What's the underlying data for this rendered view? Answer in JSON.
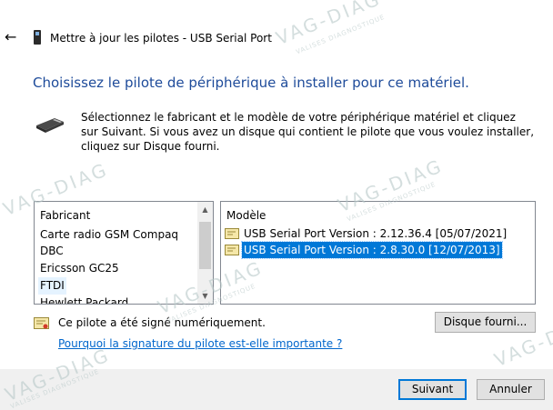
{
  "titlebar": {
    "title": "Mettre à jour les pilotes - USB Serial Port"
  },
  "heading": "Choisissez le pilote de périphérique à installer pour ce matériel.",
  "instructions": "Sélectionnez le fabricant et le modèle de votre périphérique matériel et cliquez sur Suivant. Si vous avez un disque qui contient le pilote que vous voulez installer, cliquez sur Disque fourni.",
  "manufacturers": {
    "header": "Fabricant",
    "items": [
      "Carte radio GSM Compaq",
      "DBC",
      "Ericsson GC25",
      "FTDI",
      "Hewlett Packard"
    ]
  },
  "models": {
    "header": "Modèle",
    "items": [
      "USB Serial Port Version : 2.12.36.4 [05/07/2021]",
      "USB Serial Port Version : 2.8.30.0 [12/07/2013]"
    ]
  },
  "signed_text": "Ce pilote a été signé numériquement.",
  "why_link": "Pourquoi la signature du pilote est-elle importante ?",
  "buttons": {
    "disk": "Disque fourni...",
    "next": "Suivant",
    "cancel": "Annuler"
  },
  "watermark": {
    "brand": "VAG-DIAG",
    "tagline": "VALISES DIAGNOSTIQUE"
  },
  "icons": {
    "back": "back-arrow-icon",
    "usb_device": "usb-device-icon",
    "hardware": "hardware-connector-icon",
    "certificate": "certificate-icon"
  },
  "colors": {
    "heading": "#1e4b9a",
    "selection": "#0078d7",
    "link": "#0066cc"
  }
}
